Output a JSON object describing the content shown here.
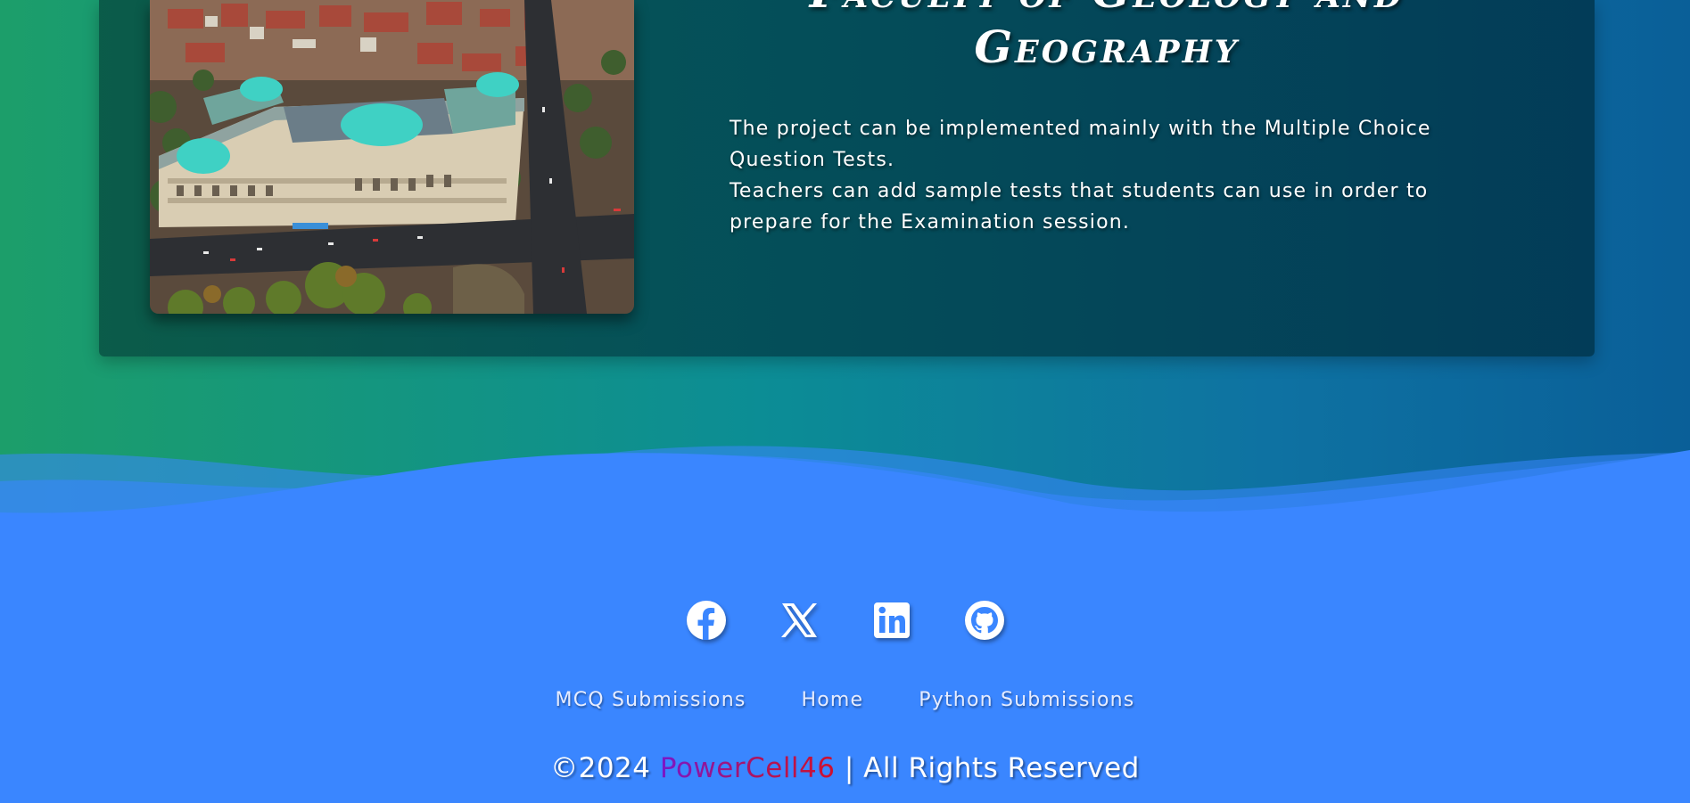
{
  "hero": {
    "title": "Faculty of Geology and Geography",
    "image_alt": "Aerial view of Sofia University building",
    "description": [
      "The project can be implemented mainly with the Multiple Choice Question Tests.",
      "Teachers can add sample tests that students can use in order to prepare for the Examination session."
    ]
  },
  "footer": {
    "social": [
      {
        "name": "facebook",
        "icon": "facebook-icon"
      },
      {
        "name": "x",
        "icon": "x-icon"
      },
      {
        "name": "linkedin",
        "icon": "linkedin-icon"
      },
      {
        "name": "github",
        "icon": "github-icon"
      }
    ],
    "links": [
      "MCQ Submissions",
      "Home",
      "Python Submissions"
    ],
    "copyright_prefix": "©2024",
    "brand": "PowerCell46",
    "copyright_suffix": "| All Rights Reserved"
  },
  "colors": {
    "footer_bg": "#3a86ff",
    "brand_start": "#7a16c9",
    "brand_end": "#d0102e"
  }
}
